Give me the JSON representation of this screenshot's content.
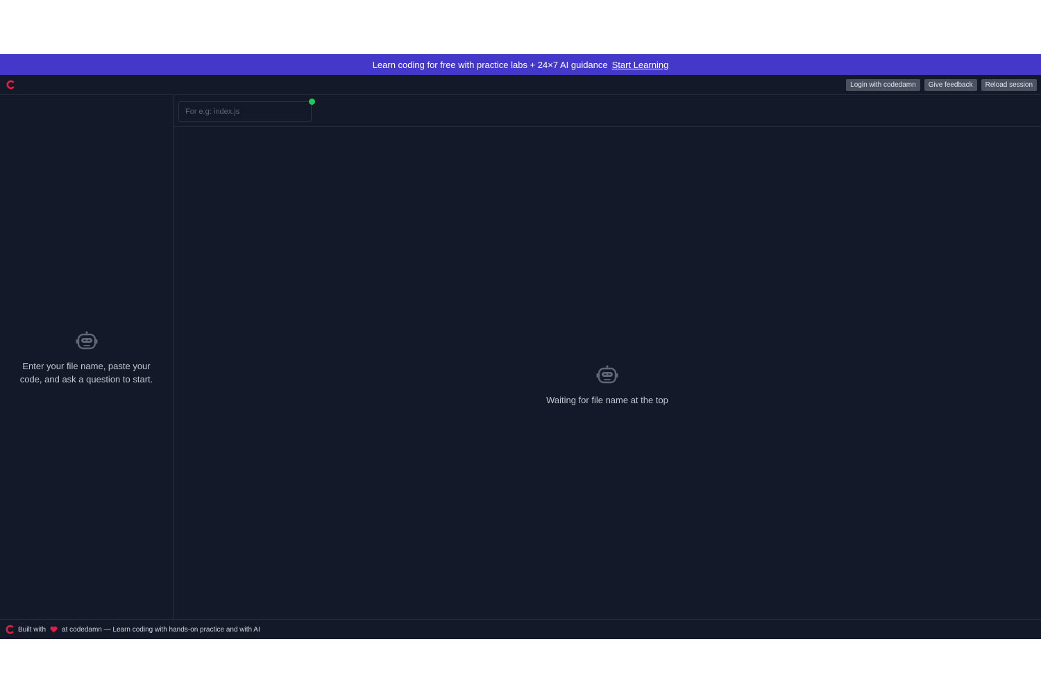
{
  "promo": {
    "text": "Learn coding for free with practice labs + 24×7 AI guidance",
    "cta_label": "Start Learning"
  },
  "topbar": {
    "buttons": [
      "Login with codedamn",
      "Give feedback",
      "Reload session"
    ]
  },
  "sidebar": {
    "message": "Enter your file name, paste your code, and ask a question to start."
  },
  "main": {
    "file_input_placeholder": "For e.g: index.js",
    "file_input_value": "",
    "waiting_message": "Waiting for file name at the top"
  },
  "footer": {
    "text_before": "Built with",
    "text_after": "at codedamn — Learn coding with hands-on practice and with AI"
  },
  "colors": {
    "brand": "#e11d48",
    "promo_bg": "#4338ca",
    "app_bg": "#131928",
    "status": "#22c55e"
  },
  "icons": {
    "logo": "codedamn-logo-icon",
    "robot": "robot-icon",
    "heart": "heart-icon"
  }
}
